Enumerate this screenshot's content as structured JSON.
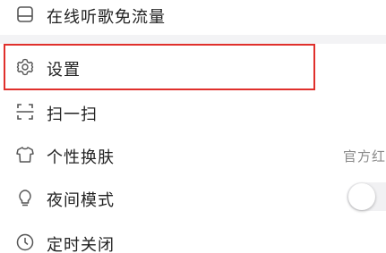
{
  "menu": {
    "items": [
      {
        "icon": "sim-card-icon",
        "label": "在线听歌免流量"
      },
      {
        "icon": "gear-icon",
        "label": "设置"
      },
      {
        "icon": "scan-icon",
        "label": "扫一扫"
      },
      {
        "icon": "shirt-icon",
        "label": "个性换肤",
        "value": "官方红"
      },
      {
        "icon": "lightbulb-icon",
        "label": "夜间模式",
        "toggle": false
      },
      {
        "icon": "clock-icon",
        "label": "定时关闭"
      }
    ]
  },
  "colors": {
    "highlight_border": "#e0302c",
    "divider": "#f3f3f5",
    "text_primary": "#222222",
    "text_secondary": "#8a8a8a"
  }
}
